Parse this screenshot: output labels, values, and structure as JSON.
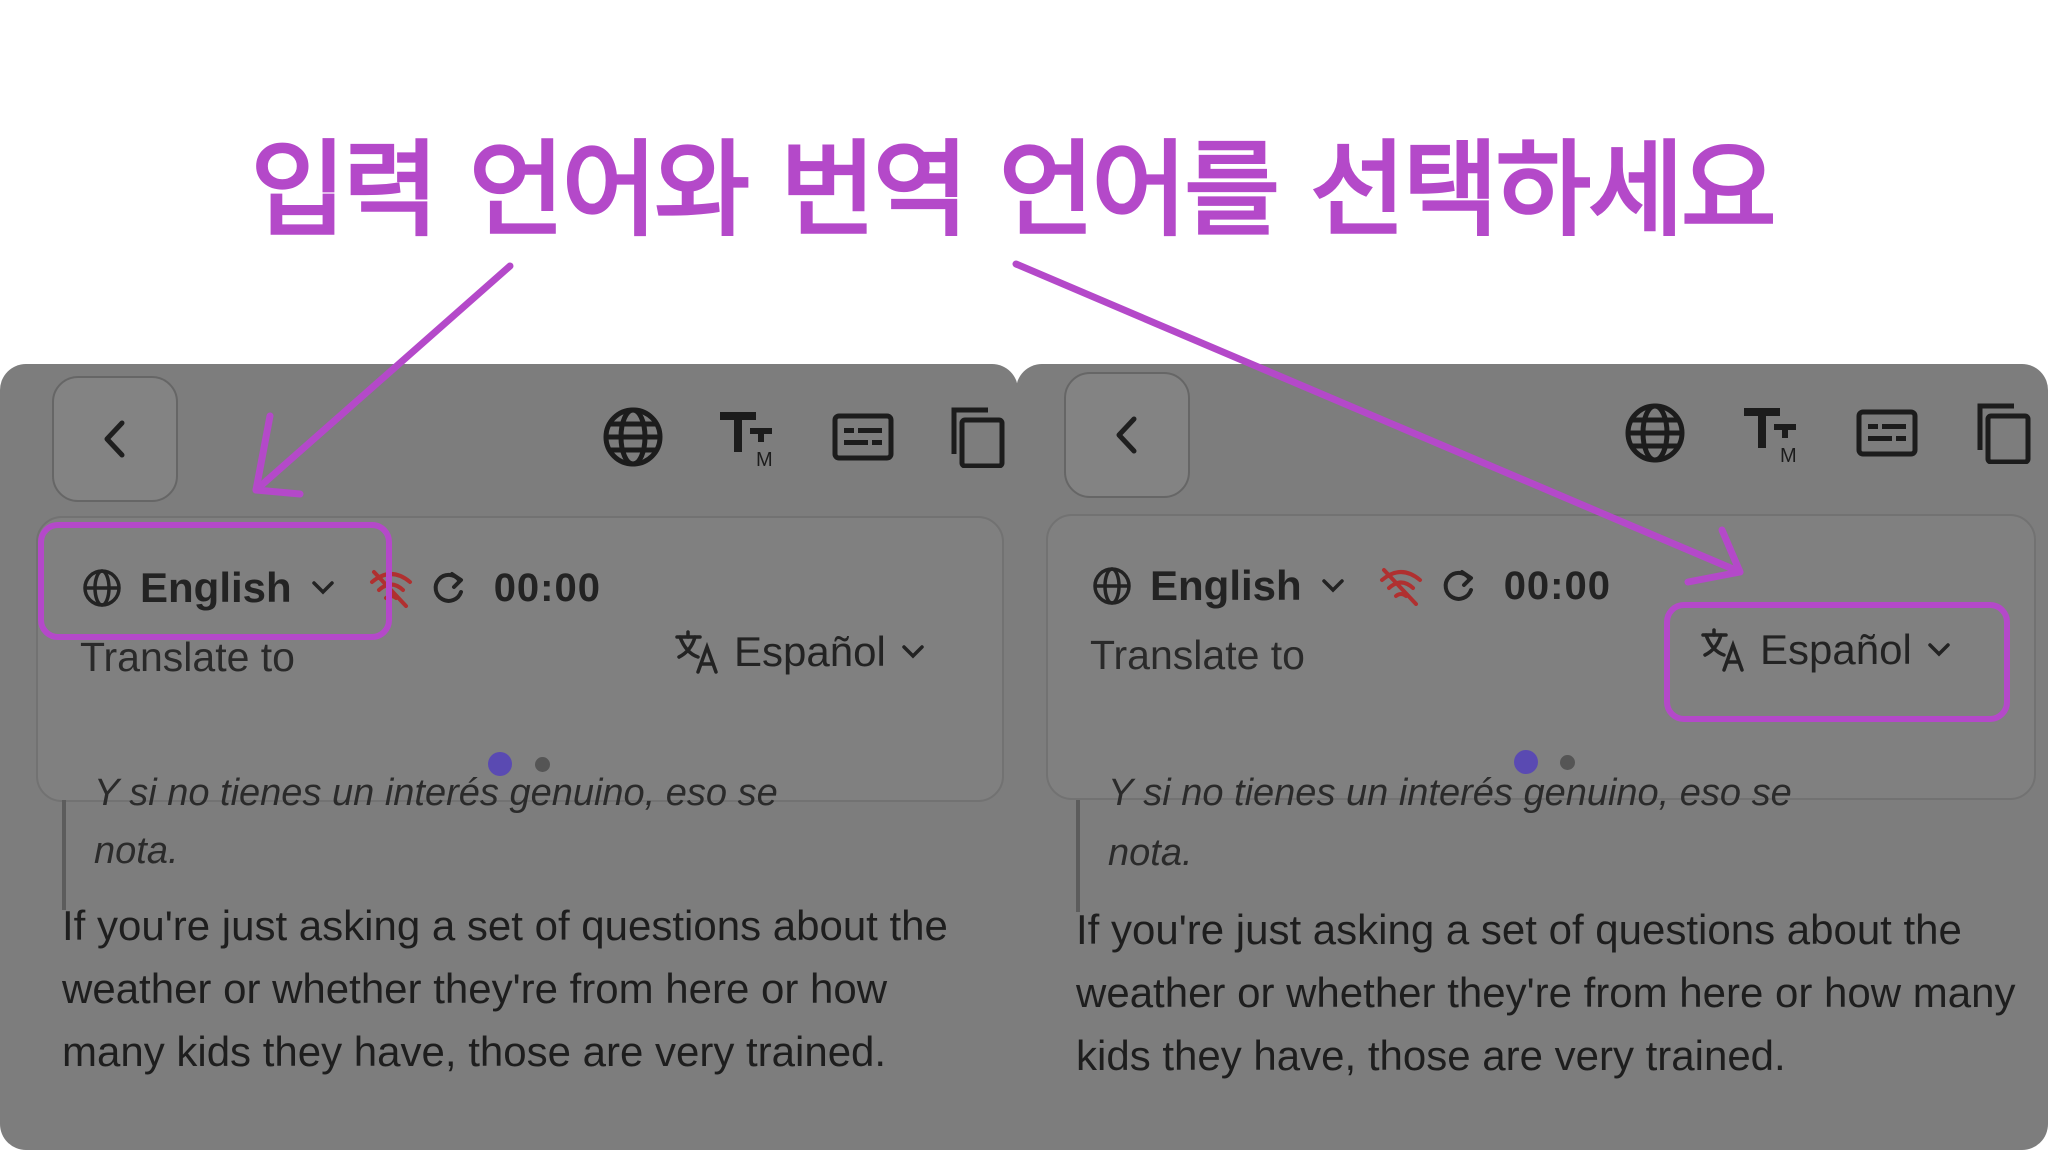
{
  "headline": "입력 언어와 번역 언어를 선택하세요",
  "colors": {
    "accent": "#b449c9",
    "overlay": "#7d7d7d",
    "dot_active": "#5a4ab2",
    "dot_inactive": "#555555",
    "wifi_off": "#b03030"
  },
  "panels": [
    {
      "source_language": "English",
      "timer": "00:00",
      "translate_to_label": "Translate to",
      "target_language": "Español",
      "quote_cut_text": "Y si no tienes un interés genuino, eso se",
      "quote_tail": "nota.",
      "paragraph": "If you're just asking a set of questions about the weather or whether they're from here or how many kids they have, those are very trained.",
      "toolbar_icons": [
        "globe-icon",
        "text-size-icon",
        "subtitles-icon",
        "copy-icon"
      ]
    },
    {
      "source_language": "English",
      "timer": "00:00",
      "translate_to_label": "Translate to",
      "target_language": "Español",
      "quote_cut_text": "Y si no tienes un interés genuino, eso se",
      "quote_tail": "nota.",
      "paragraph": "If you're just asking a set of questions about the weather or whether they're from here or how many kids they have, those are very trained.",
      "toolbar_icons": [
        "globe-icon",
        "text-size-icon",
        "subtitles-icon",
        "copy-icon"
      ]
    }
  ]
}
